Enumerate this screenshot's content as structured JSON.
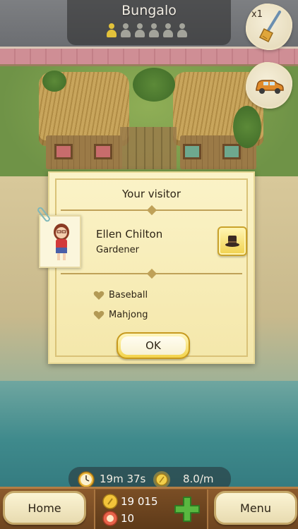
{
  "header": {
    "title": "Bungalo",
    "occupants": {
      "filled": 1,
      "total": 6
    },
    "broom_multiplier": "x1"
  },
  "dialog": {
    "title": "Your visitor",
    "visitor": {
      "name": "Ellen Chilton",
      "profession": "Gardener"
    },
    "interests": [
      "Baseball",
      "Mahjong"
    ],
    "ok_label": "OK"
  },
  "status": {
    "timer": "19m 37s",
    "rate": "8.0/m"
  },
  "footer": {
    "home_label": "Home",
    "menu_label": "Menu",
    "coins": "19 015",
    "gems": "10"
  },
  "colors": {
    "occupant_filled": "#e3c23a",
    "occupant_empty": "#a3a39a",
    "dialog_bg": "#f8eebc",
    "button_gold": "#f3d34a"
  },
  "icons": [
    "broom-icon",
    "car-icon",
    "hat-icon",
    "heart-icon",
    "clock-icon",
    "sun-icon",
    "coin-icon",
    "gem-icon",
    "plus-icon"
  ]
}
